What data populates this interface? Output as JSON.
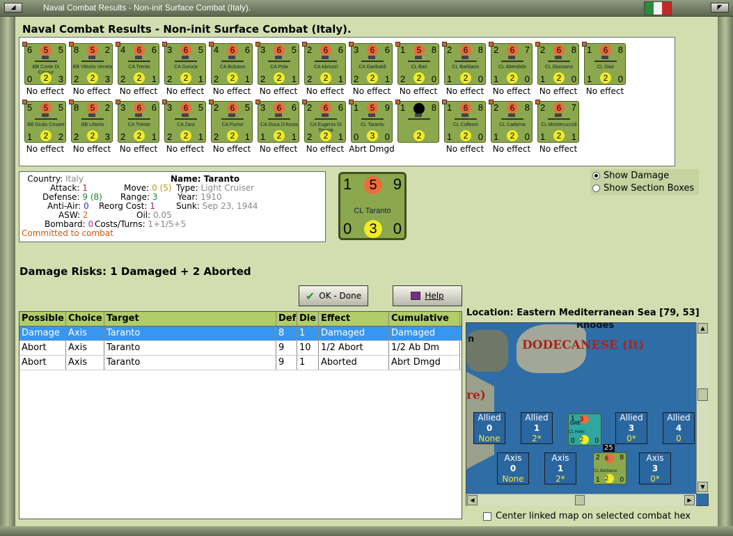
{
  "window": {
    "title": "Naval Combat Results - Non-init Surface Combat (Italy)."
  },
  "heading": "Naval Combat Results - Non-init Surface Combat (Italy).",
  "units": [
    {
      "row": 0,
      "name": "BB Conte Di Cavour",
      "tl": "6",
      "atk": "5",
      "tr": "5",
      "bl": "0",
      "def": "2",
      "br": "3",
      "effect": "No effect"
    },
    {
      "row": 0,
      "name": "BB Vittorio Veneto",
      "tl": "8",
      "atk": "5",
      "tr": "2",
      "bl": "2",
      "def": "2",
      "br": "3",
      "effect": "No effect"
    },
    {
      "row": 0,
      "name": "CA Trento",
      "tl": "4",
      "atk": "6",
      "tr": "6",
      "bl": "2",
      "def": "2",
      "br": "1",
      "effect": "No effect"
    },
    {
      "row": 0,
      "name": "CA Gorizia",
      "tl": "3",
      "atk": "6",
      "tr": "5",
      "bl": "2",
      "def": "2",
      "br": "1",
      "effect": "No effect"
    },
    {
      "row": 0,
      "name": "CA Bolzano",
      "tl": "4",
      "atk": "6",
      "tr": "6",
      "bl": "2",
      "def": "2",
      "br": "1",
      "effect": "No effect"
    },
    {
      "row": 0,
      "name": "CA Pola",
      "tl": "3",
      "atk": "6",
      "tr": "5",
      "bl": "2",
      "def": "2",
      "br": "1",
      "effect": "No effect"
    },
    {
      "row": 0,
      "name": "CA Abruzzi",
      "tl": "2",
      "atk": "6",
      "tr": "6",
      "bl": "2",
      "def": "2",
      "br": "1",
      "effect": "No effect"
    },
    {
      "row": 0,
      "name": "CA Garibaldi",
      "tl": "3",
      "atk": "6",
      "tr": "6",
      "bl": "2",
      "def": "2",
      "br": "1",
      "effect": "No effect"
    },
    {
      "row": 0,
      "name": "CL Bari",
      "tl": "1",
      "atk": "5",
      "tr": "8",
      "bl": "2",
      "def": "2",
      "br": "0",
      "effect": "No effect"
    },
    {
      "row": 0,
      "name": "CL Barbiano",
      "tl": "2",
      "atk": "6",
      "tr": "8",
      "bl": "1",
      "def": "2",
      "br": "0",
      "effect": "No effect"
    },
    {
      "row": 0,
      "name": "CL Attendolo",
      "tl": "2",
      "atk": "6",
      "tr": "7",
      "bl": "1",
      "def": "2",
      "br": "0",
      "effect": "No effect"
    },
    {
      "row": 0,
      "name": "CL Giussano",
      "tl": "2",
      "atk": "6",
      "tr": "8",
      "bl": "1",
      "def": "2",
      "br": "0",
      "effect": "No effect"
    },
    {
      "row": 0,
      "name": "CL Diaz",
      "tl": "1",
      "atk": "6",
      "tr": "8",
      "bl": "1",
      "def": "2",
      "br": "0",
      "effect": "No effect"
    },
    {
      "row": 1,
      "name": "BB Giulio Cesare",
      "tl": "5",
      "atk": "5",
      "tr": "5",
      "bl": "1",
      "def": "2",
      "br": "2",
      "effect": "No effect"
    },
    {
      "row": 1,
      "name": "BB Littorio",
      "tl": "8",
      "atk": "5",
      "tr": "2",
      "bl": "2",
      "def": "2",
      "br": "3",
      "effect": "No effect"
    },
    {
      "row": 1,
      "name": "CA Trieste",
      "tl": "3",
      "atk": "6",
      "tr": "6",
      "bl": "2",
      "def": "2",
      "br": "1",
      "effect": "No effect"
    },
    {
      "row": 1,
      "name": "CA Zara",
      "tl": "3",
      "atk": "6",
      "tr": "5",
      "bl": "2",
      "def": "2",
      "br": "1",
      "effect": "No effect"
    },
    {
      "row": 1,
      "name": "CA Fiume",
      "tl": "2",
      "atk": "6",
      "tr": "5",
      "bl": "2",
      "def": "2",
      "br": "1",
      "effect": "No effect"
    },
    {
      "row": 1,
      "name": "CA Duca D'Aosta",
      "tl": "3",
      "atk": "6",
      "tr": "6",
      "bl": "1",
      "def": "2",
      "br": "1",
      "effect": "No effect"
    },
    {
      "row": 1,
      "name": "CA Eugenio Di Savoia",
      "tl": "2",
      "atk": "6",
      "tr": "6",
      "bl": "2",
      "def": "2",
      "br": "1",
      "effect": "No effect"
    },
    {
      "row": 1,
      "name": "CL Taranto",
      "tl": "1",
      "atk": "5",
      "tr": "9",
      "bl": "0",
      "def": "3",
      "br": "0",
      "effect": "Abrt Dmgd"
    },
    {
      "row": 1,
      "name": "",
      "tl": "1",
      "atk": "",
      "tr": "8",
      "bl": "",
      "def": "2",
      "br": "",
      "effect": "",
      "black": true
    },
    {
      "row": 1,
      "name": "CL Colleoni",
      "tl": "1",
      "atk": "6",
      "tr": "8",
      "bl": "1",
      "def": "2",
      "br": "0",
      "effect": "No effect"
    },
    {
      "row": 1,
      "name": "CL Cadorna",
      "tl": "2",
      "atk": "6",
      "tr": "8",
      "bl": "1",
      "def": "2",
      "br": "0",
      "effect": "No effect"
    },
    {
      "row": 1,
      "name": "CL Montecuccoli",
      "tl": "2",
      "atk": "6",
      "tr": "7",
      "bl": "1",
      "def": "2",
      "br": "1",
      "effect": "No effect"
    }
  ],
  "info": {
    "country_lbl": "Country:",
    "country": "Italy",
    "attack_lbl": "Attack:",
    "attack": "1",
    "defense_lbl": "Defense:",
    "defense": "9",
    "defense_alt": "(8)",
    "aa_lbl": "Anti-Air:",
    "aa": "0",
    "asw_lbl": "ASW:",
    "asw": "2",
    "bombard_lbl": "Bombard:",
    "bombard": "0",
    "committed": "Committed to combat",
    "name_lbl": "Name:",
    "name": "Taranto",
    "move_lbl": "Move:",
    "move": "0",
    "move_alt": "(5)",
    "range_lbl": "Range:",
    "range": "3",
    "reorg_lbl": "Reorg Cost:",
    "reorg": "1",
    "oil_lbl": "Oil:",
    "oil": "0.05",
    "costs_lbl": "Costs/Turns:",
    "costs": "1+1/5+5",
    "type_lbl": "Type:",
    "type": "Light Cruiser",
    "year_lbl": "Year:",
    "year": "1910",
    "sunk_lbl": "Sunk:",
    "sunk": "Sep 23, 1944"
  },
  "big_counter": {
    "tl": "1",
    "atk": "5",
    "tr": "9",
    "name": "CL Taranto",
    "bl": "0",
    "def": "3",
    "br": "0"
  },
  "radios": {
    "show_damage": "Show Damage",
    "show_sections": "Show Section Boxes"
  },
  "risks": "Damage Risks:  1 Damaged + 2 Aborted",
  "buttons": {
    "ok": "OK - Done",
    "help": "Help"
  },
  "table": {
    "headers": [
      "Possible",
      "Choice",
      "Target",
      "Def",
      "Die",
      "Effect",
      "Cumulative"
    ],
    "rows": [
      [
        "Damage",
        "Axis",
        "Taranto",
        "8",
        "1",
        "Damaged",
        "Damaged"
      ],
      [
        "Abort",
        "Axis",
        "Taranto",
        "9",
        "10",
        "1/2 Abort",
        "1/2 Ab Dm"
      ],
      [
        "Abort",
        "Axis",
        "Taranto",
        "9",
        "1",
        "Aborted",
        "Abrt Dmgd"
      ]
    ]
  },
  "location": "Location:  Eastern Mediterranean Sea [79, 53]",
  "map": {
    "rhodes": "Rhodes",
    "dodecanese": "DODECANESE (It)",
    "partial_a": "n",
    "partial_b": "re)",
    "allied": [
      {
        "side": "Allied",
        "n": "0",
        "v": "None"
      },
      {
        "side": "Allied",
        "n": "1",
        "v": "2*"
      },
      {
        "side": "Allied",
        "n": "3",
        "v": "0*"
      },
      {
        "side": "Allied",
        "n": "4",
        "v": "0"
      }
    ],
    "axis": [
      {
        "side": "Axis",
        "n": "0",
        "v": "None"
      },
      {
        "side": "Axis",
        "n": "1",
        "v": "2*"
      },
      {
        "side": "Axis",
        "n": "3",
        "v": "0*"
      }
    ],
    "greek": {
      "tl": "1",
      "atk": "3",
      "name": "CL Helle",
      "nat": "GRE",
      "bl": "0",
      "def": "2",
      "br": "0"
    },
    "barbiano": {
      "tl": "2",
      "atk": "6",
      "tr": "8",
      "name": "CL Barbiano",
      "bl": "1",
      "def": "2",
      "br": "0"
    },
    "stack_count": "25"
  },
  "center_check": "Center linked map on selected combat hex",
  "colors": {
    "counter": "#8ba84e",
    "attack": "#ec6b3c",
    "defense": "#f0ec2a",
    "header": "#b1cd6a",
    "selected": "#3796f0",
    "flag_green": "#2c8a3c",
    "flag_white": "#f2f2f2",
    "flag_red": "#c22a2a"
  }
}
